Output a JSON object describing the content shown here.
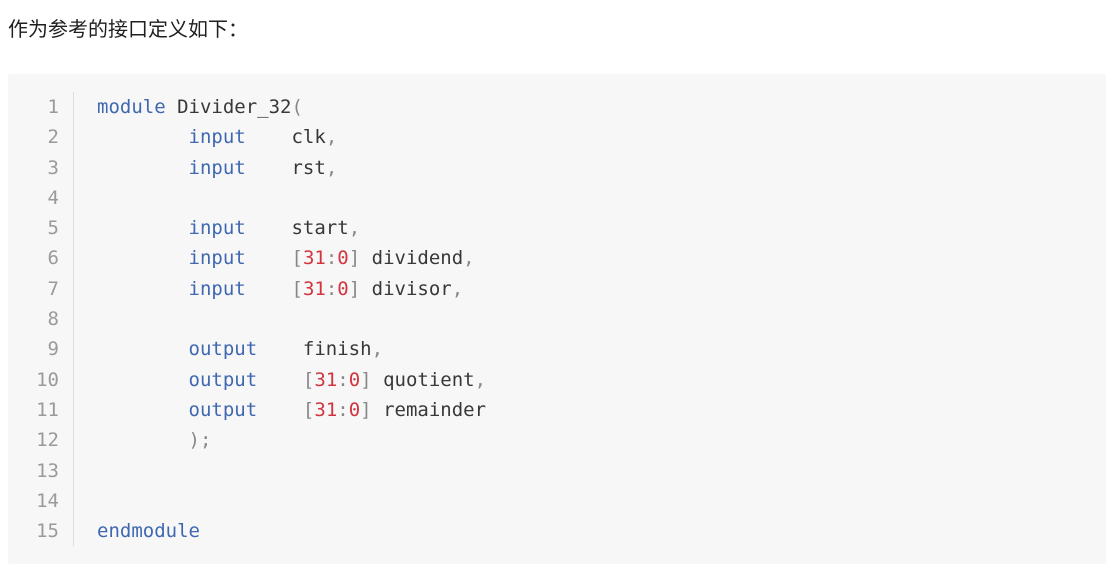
{
  "intro_text": "作为参考的接口定义如下：",
  "code": {
    "line_numbers": [
      "1",
      "2",
      "3",
      "4",
      "5",
      "6",
      "7",
      "8",
      "9",
      "10",
      "11",
      "12",
      "13",
      "14",
      "15"
    ],
    "lines": [
      {
        "kw": "module",
        "name": "Divider_32",
        "open": "("
      },
      {
        "indent": "        ",
        "kw": "input",
        "gap": "    ",
        "signal": "clk",
        "punc": ","
      },
      {
        "indent": "        ",
        "kw": "input",
        "gap": "    ",
        "signal": "rst",
        "punc": ","
      },
      {},
      {
        "indent": "        ",
        "kw": "input",
        "gap": "    ",
        "signal": "start",
        "punc": ","
      },
      {
        "indent": "        ",
        "kw": "input",
        "gap": "    ",
        "lb": "[",
        "msb": "31",
        "colon": ":",
        "lsb": "0",
        "rb": "]",
        "signal": "dividend",
        "punc": ","
      },
      {
        "indent": "        ",
        "kw": "input",
        "gap": "    ",
        "lb": "[",
        "msb": "31",
        "colon": ":",
        "lsb": "0",
        "rb": "]",
        "signal": "divisor",
        "punc": ","
      },
      {},
      {
        "indent": "        ",
        "kw": "output",
        "gap": "    ",
        "signal": "finish",
        "punc": ","
      },
      {
        "indent": "        ",
        "kw": "output",
        "gap": "    ",
        "lb": "[",
        "msb": "31",
        "colon": ":",
        "lsb": "0",
        "rb": "]",
        "signal": "quotient",
        "punc": ","
      },
      {
        "indent": "        ",
        "kw": "output",
        "gap": "    ",
        "lb": "[",
        "msb": "31",
        "colon": ":",
        "lsb": "0",
        "rb": "]",
        "signal": "remainder"
      },
      {
        "indent": "        ",
        "close": ");"
      },
      {},
      {},
      {
        "kw": "endmodule"
      }
    ]
  }
}
